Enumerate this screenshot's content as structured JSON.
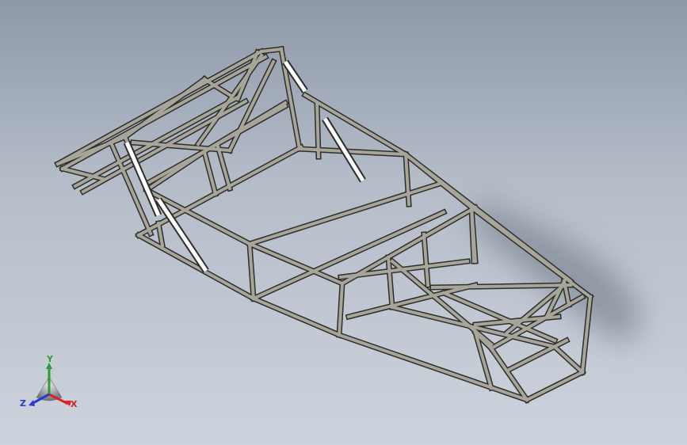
{
  "colors": {
    "tube_fill": "#a8a69a",
    "tube_edge": "#2e2e2b",
    "highlight": "#ffffff",
    "shadow": "#747c88",
    "axis_x": "#d8232a",
    "axis_y": "#2a9a3a",
    "axis_z": "#2a3ad0"
  },
  "triad": {
    "x_label": "X",
    "y_label": "Y",
    "z_label": "Z",
    "icon": "reference-triad-icon"
  }
}
